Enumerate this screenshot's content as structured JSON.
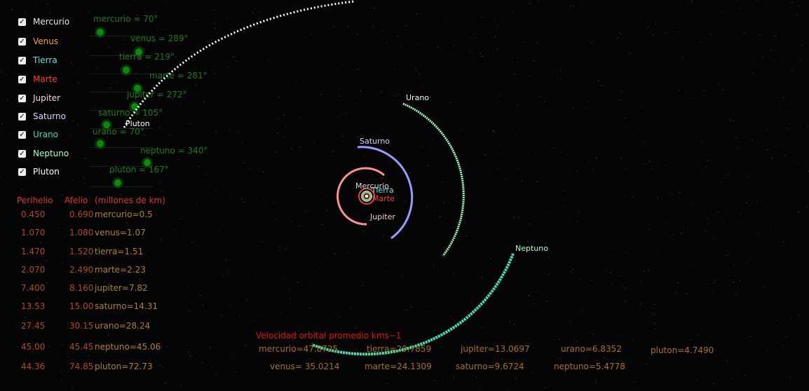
{
  "planets": [
    {
      "name": "Mercurio",
      "color": "#e6e6e6",
      "checked": true,
      "angle_label": "mercurio = 70°",
      "perihelio": "0.450",
      "afelio": "0.690",
      "dist": "mercurio=0.5"
    },
    {
      "name": "Venus",
      "color": "#f0a030",
      "checked": true,
      "angle_label": "venus = 289°",
      "perihelio": "1.070",
      "afelio": "1.080",
      "dist": "venus=1.07"
    },
    {
      "name": "Tierra",
      "color": "#60e0e0",
      "checked": true,
      "angle_label": "tierra = 219°",
      "perihelio": "1.470",
      "afelio": "1.520",
      "dist": "tierra=1.51"
    },
    {
      "name": "Marte",
      "color": "#ff3a2a",
      "checked": true,
      "angle_label": "marte = 281°",
      "perihelio": "2.070",
      "afelio": "2.490",
      "dist": "marte=2.23"
    },
    {
      "name": "Jupiter",
      "color": "#f0d8d8",
      "checked": true,
      "angle_label": "jupiter = 272°",
      "perihelio": "7.400",
      "afelio": "8.160",
      "dist": "jupiter=7.82"
    },
    {
      "name": "Saturno",
      "color": "#d8d8ff",
      "checked": true,
      "angle_label": "saturno = 105°",
      "perihelio": "13.53",
      "afelio": "15.00",
      "dist": "saturno=14.31"
    },
    {
      "name": "Urano",
      "color": "#40e0b0",
      "checked": true,
      "angle_label": "urano = 70°",
      "perihelio": "27.45",
      "afelio": "30.15",
      "dist": "urano=28.24"
    },
    {
      "name": "Neptuno",
      "color": "#a0ffc0",
      "checked": true,
      "angle_label": "neptuno = 340°",
      "perihelio": "45.00",
      "afelio": "45.45",
      "dist": "neptuno=45.06"
    },
    {
      "name": "Pluton",
      "color": "#ffffff",
      "checked": true,
      "angle_label": "pluton = 167°",
      "perihelio": "44.36",
      "afelio": "74.85",
      "dist": "pluton=72.73"
    }
  ],
  "table_header": {
    "perihelio": "Perihelio",
    "afelio": "Afelio",
    "units": "(millones de km)"
  },
  "velocity": {
    "title": "Velocidad orbital promedio kms−1",
    "items": [
      "mercurio=47.8725",
      "venus= 35.0214",
      "tierra=29.7859",
      "marte=24.1309",
      "jupiter=13.0697",
      "saturno=9.6724",
      "urano=6.8352",
      "neptuno=5.4778",
      "pluton=4.7490"
    ]
  },
  "orbit_labels": {
    "mercurio": "Mercurio",
    "tierra": "Tierra",
    "marte": "Marte",
    "jupiter": "Jupiter",
    "saturno": "Saturno",
    "urano": "Urano",
    "neptuno": "Neptuno",
    "pluton": "Pluton"
  }
}
